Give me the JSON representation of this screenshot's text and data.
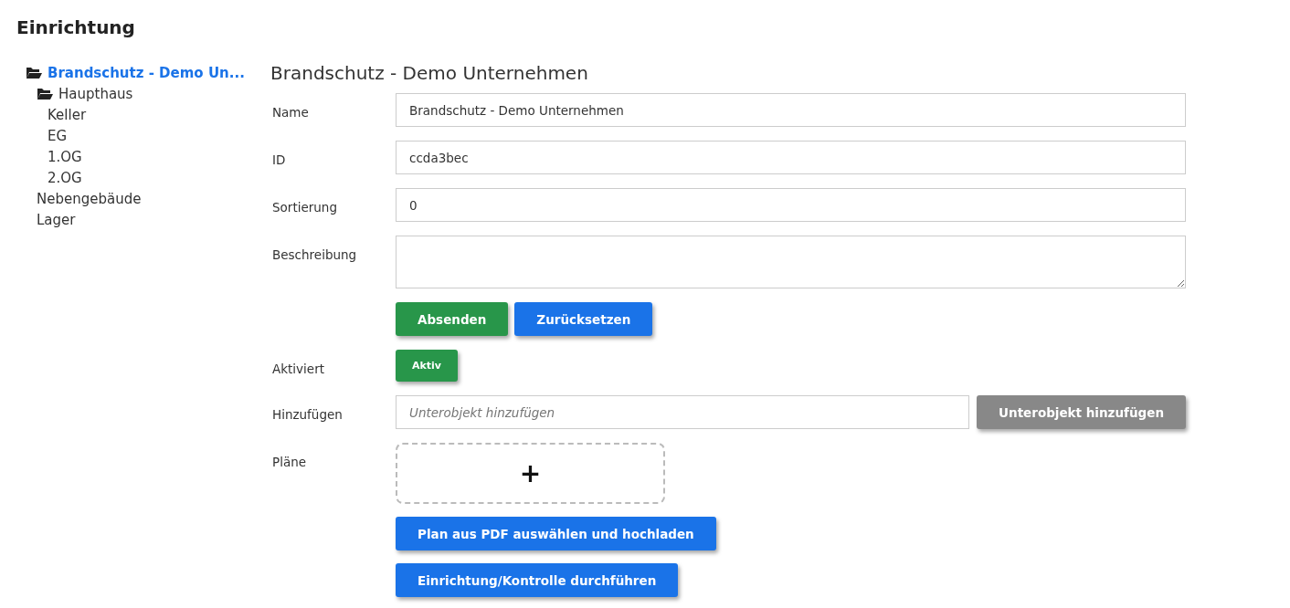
{
  "page_title": "Einrichtung",
  "tree": [
    {
      "label": "Brandschutz - Demo Un...",
      "selected": true,
      "expanded": true,
      "children": [
        {
          "label": "Haupthaus",
          "selected": false,
          "expanded": true,
          "children": [
            {
              "label": "Keller",
              "selected": false
            },
            {
              "label": "EG",
              "selected": false
            },
            {
              "label": "1.OG",
              "selected": false
            },
            {
              "label": "2.OG",
              "selected": false
            }
          ]
        },
        {
          "label": "Nebengebäude",
          "selected": false
        },
        {
          "label": "Lager",
          "selected": false
        }
      ]
    }
  ],
  "form": {
    "heading": "Brandschutz - Demo Unternehmen",
    "fields": [
      {
        "label": "Name",
        "value": "Brandschutz - Demo Unternehmen",
        "kind": "text"
      },
      {
        "label": "ID",
        "value": "ccda3bec",
        "kind": "text"
      },
      {
        "label": "Sortierung",
        "value": "0",
        "kind": "text"
      },
      {
        "label": "Beschreibung",
        "kind": "textarea"
      }
    ],
    "submit_button": "Absenden",
    "reset_button": "Zurücksetzen",
    "activated": {
      "label": "Aktiviert",
      "button": "Aktiv",
      "on": true
    },
    "add": {
      "label": "Hinzufügen",
      "placeholder": "Unterobjekt hinzufügen",
      "button": "Unterobjekt hinzufügen",
      "disabled": true
    },
    "plans": {
      "label": "Pläne",
      "add_symbol": "+",
      "upload_button": "Plan aus PDF auswählen und hochladen"
    },
    "run_button": "Einrichtung/Kontrolle durchführen"
  }
}
